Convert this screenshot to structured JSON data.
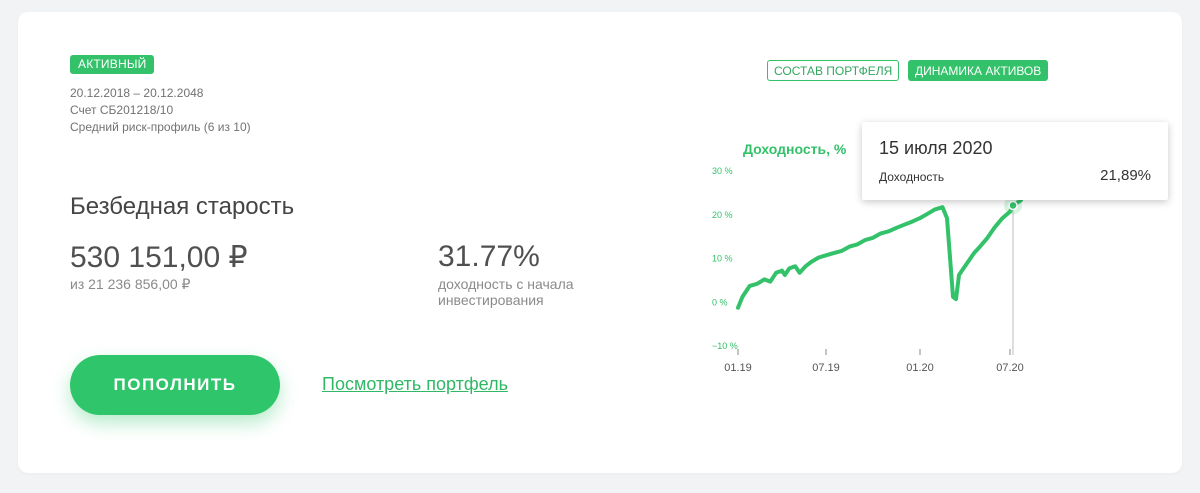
{
  "status_badge": "АКТИВНЫЙ",
  "period": "20.12.2018 – 20.12.2048",
  "account": "Счет СБ201218/10",
  "risk_profile": "Средний риск-профиль (6 из 10)",
  "portfolio_name": "Безбедная старость",
  "balance": "530 151,00 ₽",
  "balance_sub": "из 21 236 856,00 ₽",
  "yield_value": "31.77%",
  "yield_sub": "доходность с начала инвестирования",
  "topup_button": "ПОПОЛНИТЬ",
  "view_portfolio_link": "Посмотреть портфель",
  "tabs": {
    "composition": "СОСТАВ ПОРТФЕЛЯ",
    "dynamics": "ДИНАМИКА АКТИВОВ"
  },
  "tooltip": {
    "date": "15 июля 2020",
    "label": "Доходность",
    "value": "21,89%"
  },
  "colors": {
    "accent": "#33c26a",
    "text": "#454545",
    "muted": "#8a8a8a"
  },
  "chart_data": {
    "type": "line",
    "title": "Доходность, %",
    "ylim": [
      -10,
      30
    ],
    "y_ticks": [
      "30 %",
      "20 %",
      "10 %",
      "0 %",
      "−10 %"
    ],
    "y_tick_values": [
      30,
      20,
      10,
      0,
      -10
    ],
    "x_ticks": [
      "01.19",
      "07.19",
      "01.20",
      "07.20"
    ],
    "x_tick_values": [
      0,
      6,
      12,
      18
    ],
    "grid": false,
    "series": [
      {
        "values": [
          [
            0.0,
            -1.5
          ],
          [
            0.3,
            1.0
          ],
          [
            0.8,
            3.5
          ],
          [
            1.3,
            4.0
          ],
          [
            1.8,
            5.0
          ],
          [
            2.2,
            4.5
          ],
          [
            2.6,
            6.5
          ],
          [
            3.0,
            7.0
          ],
          [
            3.2,
            6.0
          ],
          [
            3.5,
            7.5
          ],
          [
            3.9,
            8.0
          ],
          [
            4.2,
            6.5
          ],
          [
            4.6,
            8.0
          ],
          [
            5.0,
            9.0
          ],
          [
            5.5,
            10.0
          ],
          [
            6.0,
            10.5
          ],
          [
            6.5,
            11.0
          ],
          [
            7.0,
            11.5
          ],
          [
            7.5,
            12.5
          ],
          [
            8.0,
            13.0
          ],
          [
            8.5,
            14.0
          ],
          [
            9.0,
            14.5
          ],
          [
            9.5,
            15.5
          ],
          [
            10.0,
            16.0
          ],
          [
            10.5,
            16.8
          ],
          [
            11.0,
            17.5
          ],
          [
            11.5,
            18.2
          ],
          [
            12.0,
            19.0
          ],
          [
            12.5,
            20.0
          ],
          [
            13.0,
            21.0
          ],
          [
            13.5,
            21.5
          ],
          [
            13.8,
            19.0
          ],
          [
            14.0,
            10.0
          ],
          [
            14.2,
            1.0
          ],
          [
            14.4,
            0.5
          ],
          [
            14.6,
            6.0
          ],
          [
            14.9,
            7.5
          ],
          [
            15.2,
            9.0
          ],
          [
            15.6,
            11.0
          ],
          [
            16.0,
            12.5
          ],
          [
            16.5,
            14.5
          ],
          [
            17.0,
            17.0
          ],
          [
            17.5,
            19.0
          ],
          [
            18.0,
            20.5
          ],
          [
            18.2,
            21.9
          ],
          [
            18.7,
            23.0
          ],
          [
            19.2,
            25.5
          ],
          [
            19.7,
            26.5
          ],
          [
            20.2,
            28.0
          ],
          [
            20.7,
            28.5
          ],
          [
            21.3,
            29.0
          ],
          [
            22.0,
            28.0
          ],
          [
            22.7,
            28.5
          ]
        ]
      }
    ],
    "highlight": {
      "x": 18.2,
      "y": 21.89
    }
  }
}
